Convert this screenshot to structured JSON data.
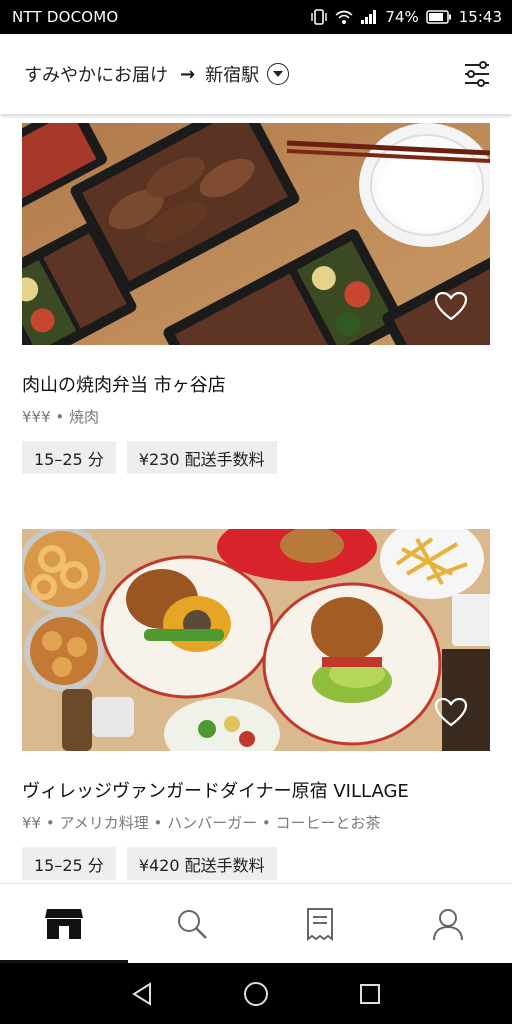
{
  "status_bar": {
    "carrier": "NTT DOCOMO",
    "battery": "74%",
    "time": "15:43"
  },
  "header": {
    "delivery_option": "すみやかにお届け",
    "arrow": "→",
    "location": "新宿駅"
  },
  "restaurants": [
    {
      "name": "肉山の焼肉弁当 市ヶ谷店",
      "meta": "¥¥¥ • 焼肉",
      "time": "15–25 分",
      "fee": "¥230 配送手数料"
    },
    {
      "name": "ヴィレッジヴァンガードダイナー原宿 VILLAGE",
      "meta": "¥¥ • アメリカ料理 • ハンバーガー • コーヒーとお茶",
      "time": "15–25 分",
      "fee": "¥420 配送手数料"
    }
  ],
  "bottom_nav": {
    "items": [
      {
        "icon": "home-store-icon",
        "active": true
      },
      {
        "icon": "search-icon",
        "active": false
      },
      {
        "icon": "orders-receipt-icon",
        "active": false
      },
      {
        "icon": "account-icon",
        "active": false
      }
    ]
  },
  "colors": {
    "status_bar_bg": "#000000",
    "tag_bg": "#eeeeee",
    "meta_text": "#7a7a7a",
    "active_indicator": "#111111"
  }
}
